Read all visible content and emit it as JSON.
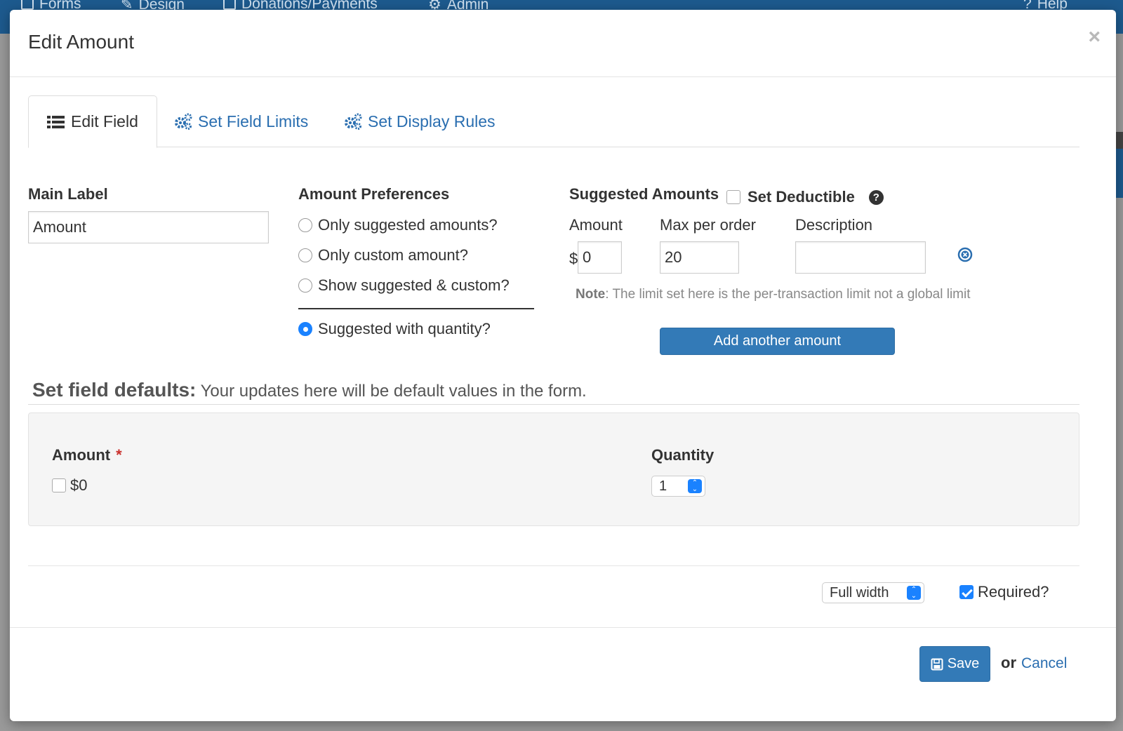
{
  "background_nav": {
    "items": [
      "Forms",
      "Design",
      "Donations/Payments",
      "Admin"
    ],
    "help": "Help"
  },
  "modal": {
    "title": "Edit Amount",
    "close": "×"
  },
  "tabs": [
    {
      "label": "Edit Field",
      "icon": "list-icon",
      "active": true
    },
    {
      "label": "Set Field Limits",
      "icon": "gears-icon",
      "active": false
    },
    {
      "label": "Set Display Rules",
      "icon": "gears-icon",
      "active": false
    }
  ],
  "main_label": {
    "heading": "Main Label",
    "value": "Amount"
  },
  "amount_preferences": {
    "heading": "Amount Preferences",
    "options": [
      {
        "label": "Only suggested amounts?",
        "checked": false
      },
      {
        "label": "Only custom amount?",
        "checked": false
      },
      {
        "label": "Show suggested & custom?",
        "checked": false
      },
      {
        "label": "Suggested with quantity?",
        "checked": true
      }
    ]
  },
  "suggested_amounts": {
    "heading": "Suggested Amounts",
    "deductible_label": "Set Deductible",
    "deductible_checked": false,
    "columns": {
      "amount": "Amount",
      "max": "Max per order",
      "description": "Description"
    },
    "currency": "$",
    "row": {
      "amount": "0",
      "max": "20",
      "description": ""
    },
    "note_label": "Note",
    "note_text": ": The limit set here is the per-transaction limit not a global limit",
    "add_button": "Add another amount"
  },
  "defaults": {
    "heading_bold": "Set field defaults:",
    "heading_text": " Your updates here will be default values in the form.",
    "amount_label": "Amount",
    "required_mark": "*",
    "amount_option": "$0",
    "quantity_label": "Quantity",
    "quantity_value": "1"
  },
  "footer_options": {
    "width_value": "Full width",
    "required_label": "Required?",
    "required_checked": true
  },
  "actions": {
    "save": "Save",
    "or": "or",
    "cancel": "Cancel"
  },
  "colors": {
    "primary": "#337ab7",
    "link": "#2a6eb0",
    "nav": "#1d5a8e",
    "checked_blue": "#1a82ff"
  }
}
